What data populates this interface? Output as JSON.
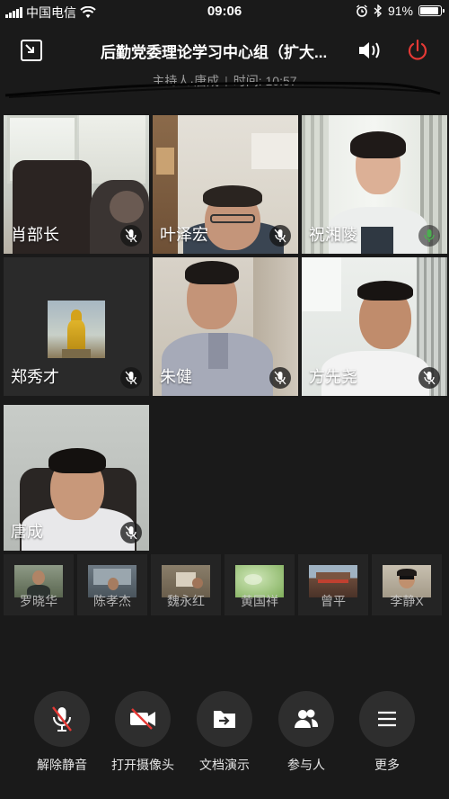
{
  "status_bar": {
    "carrier": "中国电信",
    "time": "09:06",
    "battery_percent": "91%",
    "battery_level": 0.91
  },
  "meeting": {
    "title": "后勤党委理论学习中心组（扩大...",
    "host_label": "主持人·唐成",
    "separator": "|",
    "duration_label": "时间: 10:57"
  },
  "participants": [
    {
      "name": "肖部长",
      "muted": true
    },
    {
      "name": "叶泽宏",
      "muted": true
    },
    {
      "name": "祝湘陵",
      "muted": false,
      "speaking": true
    },
    {
      "name": "郑秀才",
      "muted": true
    },
    {
      "name": "朱健",
      "muted": true
    },
    {
      "name": "方先尧",
      "muted": true
    },
    {
      "name": "唐成",
      "muted": true
    }
  ],
  "thumbnails": [
    {
      "name": "罗晓华"
    },
    {
      "name": "陈孝杰"
    },
    {
      "name": "魏永红"
    },
    {
      "name": "黄国祥"
    },
    {
      "name": "曾平"
    },
    {
      "name": "李静X"
    }
  ],
  "toolbar": {
    "unmute": "解除静音",
    "camera": "打开摄像头",
    "share_doc": "文档演示",
    "participants": "参与人",
    "more": "更多"
  },
  "colors": {
    "background": "#1a1a1a",
    "end_call_red": "#e53935",
    "speaking_green": "#4caf50",
    "mute_red": "#e53935"
  }
}
